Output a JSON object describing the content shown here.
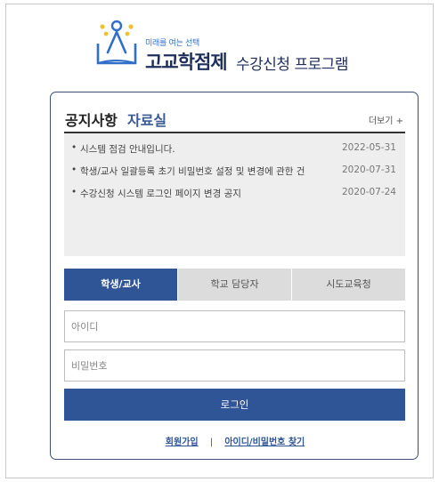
{
  "header": {
    "tagline": "미래를 여는 선택",
    "title": "고교학점제",
    "subtitle": "수강신청 프로그램",
    "logo_icon": "person-book-logo"
  },
  "notice": {
    "tabs": [
      {
        "label": "공지사항",
        "active": true
      },
      {
        "label": "자료실",
        "active": false
      }
    ],
    "more_label": "더보기 +",
    "items": [
      {
        "title": "시스템 점검 안내입니다.",
        "date": "2022-05-31"
      },
      {
        "title": "학생/교사 일괄등록 초기 비밀번호 설정 및 변경에 관한 건",
        "date": "2020-07-31"
      },
      {
        "title": "수강신청 시스템 로그인 페이지 변경 공지",
        "date": "2020-07-24"
      }
    ]
  },
  "login": {
    "role_tabs": [
      {
        "label": "학생/교사",
        "active": true
      },
      {
        "label": "학교 담당자",
        "active": false
      },
      {
        "label": "시도교육청",
        "active": false
      }
    ],
    "id_placeholder": "아이디",
    "password_placeholder": "비밀번호",
    "submit_label": "로그인",
    "signup_label": "회원가입",
    "separator": "|",
    "find_label": "아이디/비밀번호 찾기"
  },
  "colors": {
    "accent": "#2f5596",
    "title_navy": "#1f2f5c",
    "logo_blue": "#2f6fc9",
    "logo_yellow": "#f2c12e",
    "card_border": "#3c4e73"
  }
}
